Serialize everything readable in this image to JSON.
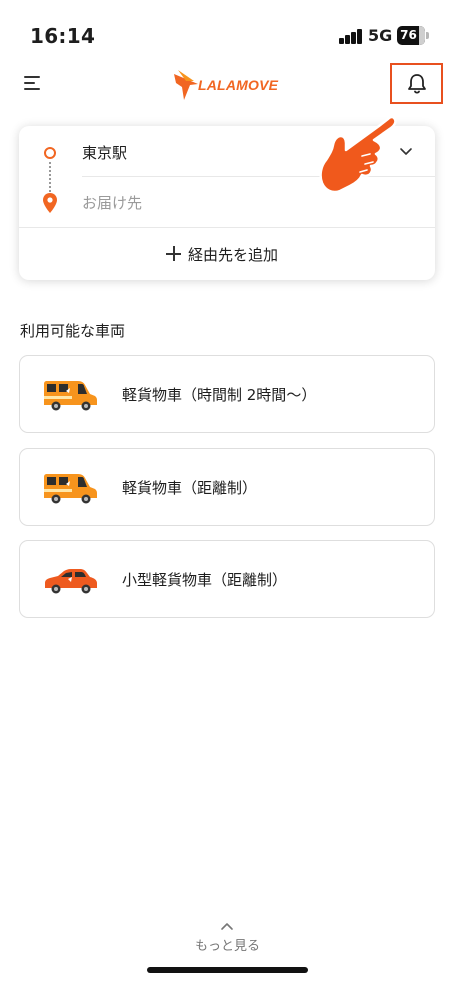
{
  "status_bar": {
    "time": "16:14",
    "network": "5G",
    "battery": "76",
    "icons": [
      "signal-bars-icon",
      "battery-icon"
    ]
  },
  "header": {
    "logo_text": "LALAMOVE",
    "icons": [
      "menu-icon",
      "lalamove-bird-icon",
      "bell-icon"
    ]
  },
  "route": {
    "pickup": "東京駅",
    "dropoff_placeholder": "お届け先",
    "add_stop": "経由先を追加",
    "icons": [
      "pickup-circle-icon",
      "drop-pin-icon",
      "chevron-down-icon",
      "plus-icon",
      "pointing-hand-icon"
    ]
  },
  "vehicles": {
    "title": "利用可能な車両",
    "items": [
      {
        "label": "軽貨物車（時間制 2時間〜）",
        "icon": "kei-van-icon"
      },
      {
        "label": "軽貨物車（距離制）",
        "icon": "kei-van-icon"
      },
      {
        "label": "小型軽貨物車（距離制）",
        "icon": "compact-car-icon"
      }
    ]
  },
  "footer": {
    "more": "もっと見る",
    "icons": [
      "chevron-up-icon"
    ]
  },
  "colors": {
    "brand": "#f16622",
    "highlight_box": "#e8501f",
    "text": "#1e1e1e",
    "placeholder": "#9a9a9a"
  }
}
